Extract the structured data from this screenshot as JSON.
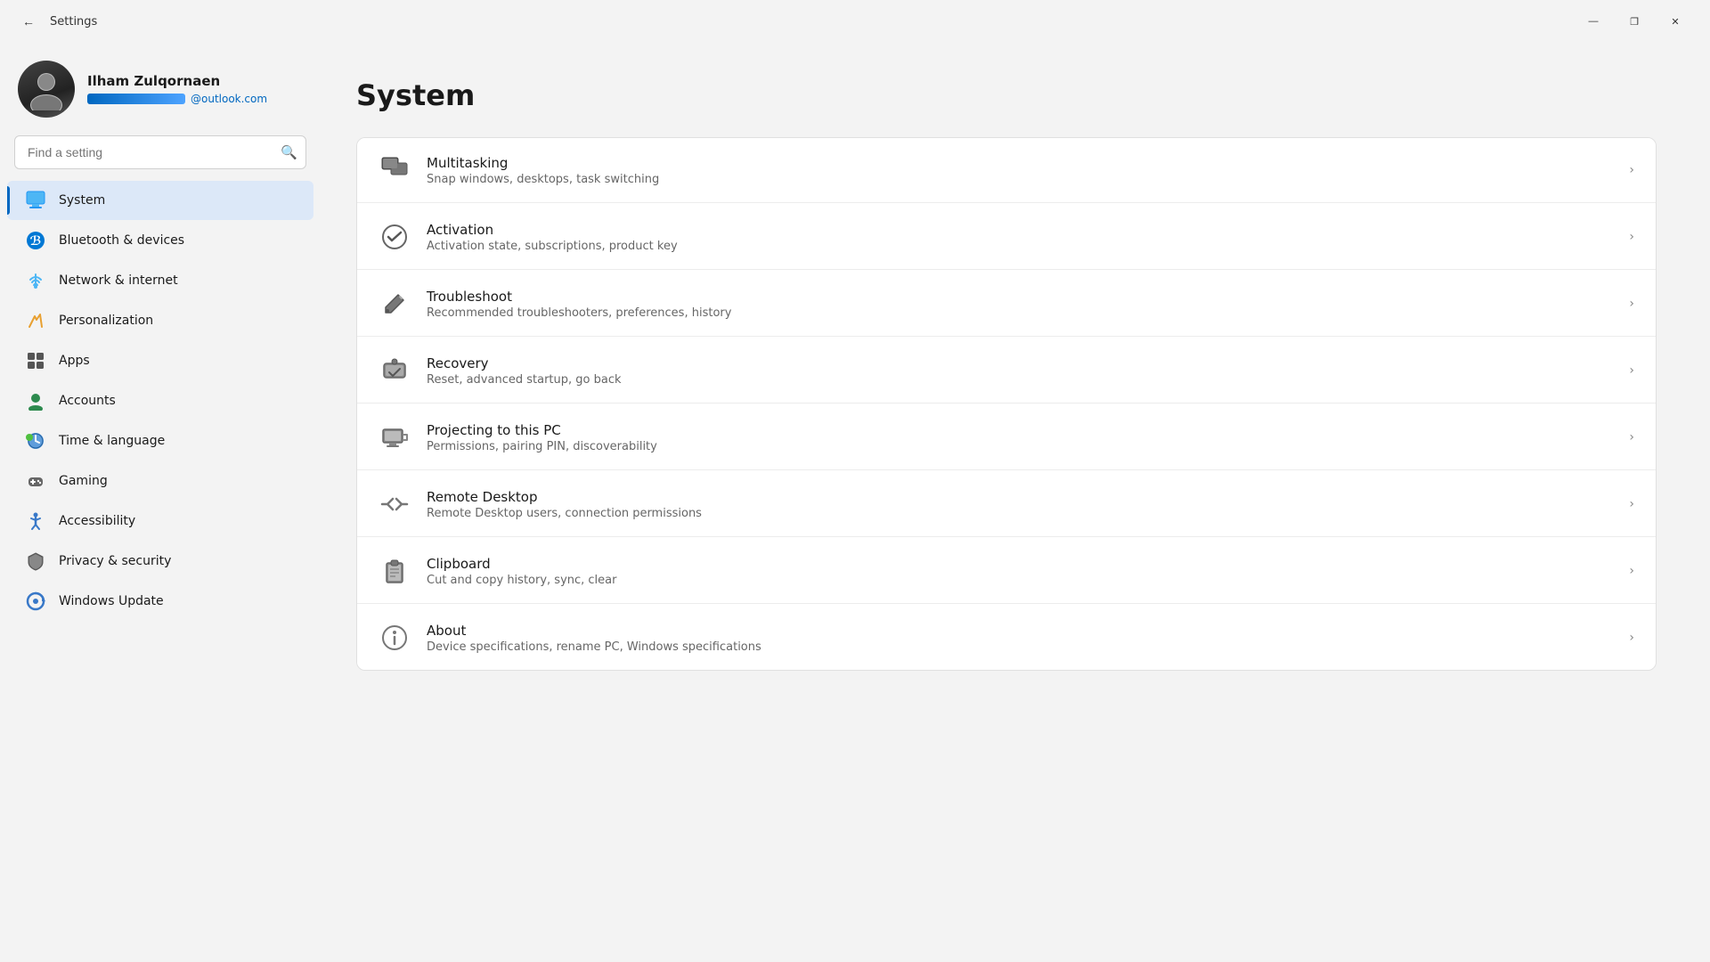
{
  "titlebar": {
    "back_label": "←",
    "title": "Settings",
    "minimize": "—",
    "maximize": "❐",
    "close": "✕"
  },
  "profile": {
    "name": "Ilham Zulqornaen",
    "email": "@outlook.com",
    "avatar_initials": "👤"
  },
  "search": {
    "placeholder": "Find a setting"
  },
  "nav": {
    "items": [
      {
        "id": "system",
        "label": "System",
        "icon": "🖥",
        "active": true
      },
      {
        "id": "bluetooth",
        "label": "Bluetooth & devices",
        "icon": "⚡",
        "active": false
      },
      {
        "id": "network",
        "label": "Network & internet",
        "icon": "🌐",
        "active": false
      },
      {
        "id": "personalization",
        "label": "Personalization",
        "icon": "✏",
        "active": false
      },
      {
        "id": "apps",
        "label": "Apps",
        "icon": "📦",
        "active": false
      },
      {
        "id": "accounts",
        "label": "Accounts",
        "icon": "👤",
        "active": false
      },
      {
        "id": "time",
        "label": "Time & language",
        "icon": "🌍",
        "active": false
      },
      {
        "id": "gaming",
        "label": "Gaming",
        "icon": "🎮",
        "active": false
      },
      {
        "id": "accessibility",
        "label": "Accessibility",
        "icon": "♿",
        "active": false
      },
      {
        "id": "privacy",
        "label": "Privacy & security",
        "icon": "🛡",
        "active": false
      },
      {
        "id": "windows-update",
        "label": "Windows Update",
        "icon": "🔄",
        "active": false
      }
    ]
  },
  "main": {
    "page_title": "System",
    "settings_items": [
      {
        "id": "multitasking",
        "title": "Multitasking",
        "desc": "Snap windows, desktops, task switching",
        "icon": "⊞"
      },
      {
        "id": "activation",
        "title": "Activation",
        "desc": "Activation state, subscriptions, product key",
        "icon": "✅"
      },
      {
        "id": "troubleshoot",
        "title": "Troubleshoot",
        "desc": "Recommended troubleshooters, preferences, history",
        "icon": "🔧"
      },
      {
        "id": "recovery",
        "title": "Recovery",
        "desc": "Reset, advanced startup, go back",
        "icon": "↩"
      },
      {
        "id": "projecting",
        "title": "Projecting to this PC",
        "desc": "Permissions, pairing PIN, discoverability",
        "icon": "📺"
      },
      {
        "id": "remote-desktop",
        "title": "Remote Desktop",
        "desc": "Remote Desktop users, connection permissions",
        "icon": "⇥"
      },
      {
        "id": "clipboard",
        "title": "Clipboard",
        "desc": "Cut and copy history, sync, clear",
        "icon": "📋"
      },
      {
        "id": "about",
        "title": "About",
        "desc": "Device specifications, rename PC, Windows specifications",
        "icon": "ℹ"
      }
    ]
  }
}
